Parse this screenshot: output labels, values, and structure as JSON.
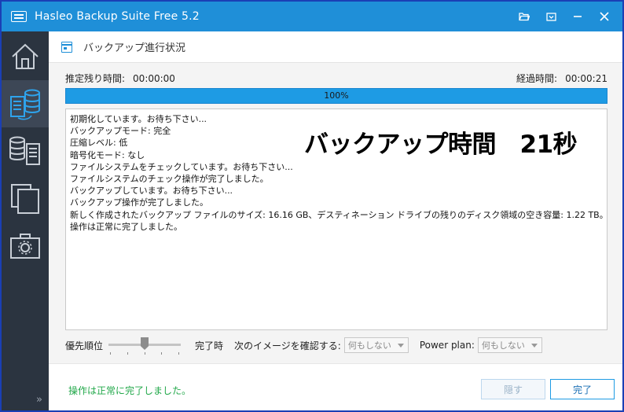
{
  "window": {
    "title": "Hasleo Backup Suite Free 5.2",
    "controls": [
      "folder-open-icon",
      "dropdown-menu-icon",
      "minimize-icon",
      "close-icon"
    ]
  },
  "sidebar": {
    "items": [
      {
        "name": "home",
        "icon": "home-icon",
        "active": false
      },
      {
        "name": "backup",
        "icon": "backup-icon",
        "active": true
      },
      {
        "name": "restore",
        "icon": "restore-icon",
        "active": false
      },
      {
        "name": "clone",
        "icon": "clone-icon",
        "active": false
      },
      {
        "name": "tools",
        "icon": "toolbox-icon",
        "active": false
      }
    ],
    "expand_glyph": "»"
  },
  "section": {
    "title": "バックアップ進行状況"
  },
  "times": {
    "remaining_label": "推定残り時間:",
    "remaining_value": "00:00:00",
    "elapsed_label": "経過時間:",
    "elapsed_value": "00:00:21"
  },
  "progress": {
    "percent": 100,
    "text": "100%"
  },
  "log": [
    "初期化しています。お待ち下さい...",
    "バックアップモード: 完全",
    "圧縮レベル: 低",
    "暗号化モード: なし",
    "ファイルシステムをチェックしています。お待ち下さい...",
    "ファイルシステムのチェック操作が完了しました。",
    "バックアップしています。お待ち下さい...",
    "バックアップ操作が完了しました。",
    "新しく作成されたバックアップ ファイルのサイズ: 16.16 GB、デスティネーション ドライブの残りのディスク領域の空き容量: 1.22 TB。",
    "操作は正常に完了しました。"
  ],
  "overlay": {
    "text": "バックアップ時間　21秒"
  },
  "options": {
    "priority_label": "優先順位",
    "priority_level": 0.5,
    "on_complete_label": "完了時",
    "verify_label": "次のイメージを確認する:",
    "verify_value": "何もしない",
    "power_plan_label": "Power plan:",
    "power_plan_value": "何もしない"
  },
  "footer": {
    "status": "操作は正常に完了しました。",
    "hide_button": "隠す",
    "done_button": "完了"
  },
  "colors": {
    "titlebar": "#1f8fd8",
    "sidebar": "#2b3440",
    "progress": "#1e9be4",
    "success": "#22a84a"
  }
}
